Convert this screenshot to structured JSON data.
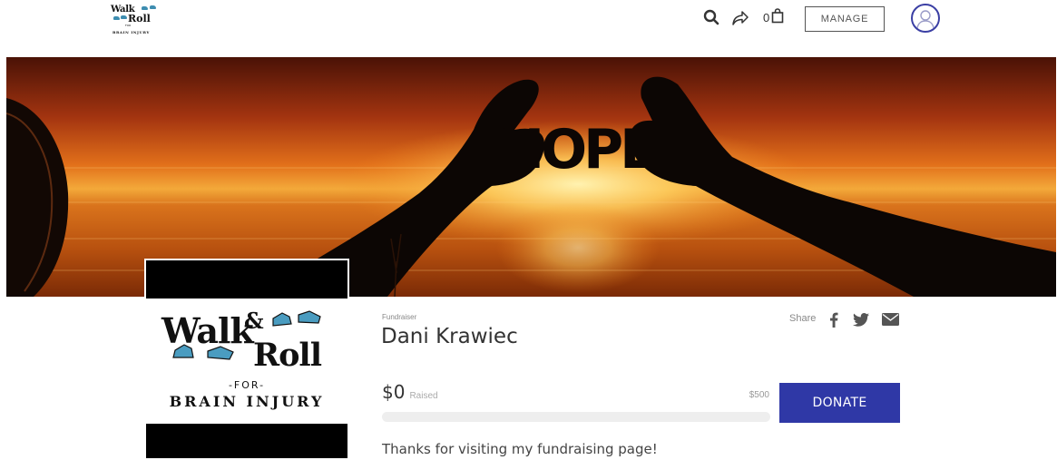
{
  "header": {
    "logo": {
      "line1": "Walk",
      "line2": "Roll",
      "line3": "FOR",
      "line4": "BRAIN INJURY"
    },
    "search_icon": "search-icon",
    "share_icon": "share-arrow-icon",
    "cart": {
      "count": "0",
      "icon": "shopping-bag-icon"
    },
    "manage_label": "MANAGE",
    "avatar_icon": "user-avatar-icon"
  },
  "banner": {
    "image_text": "HOPE",
    "description": "Sunset over the sea with silhouetted hands holding the word HOPE"
  },
  "logo_card": {
    "walk": "Walk",
    "amp": "&",
    "roll": "Roll",
    "for": "-FOR-",
    "brain_injury": "BRAIN INJURY"
  },
  "fundraiser": {
    "tag": "Fundraiser",
    "name": "Dani Krawiec",
    "share_label": "Share",
    "social_icons": [
      "facebook-icon",
      "twitter-icon",
      "email-icon"
    ],
    "raised_amount": "$0",
    "raised_label": "Raised",
    "goal": "$500",
    "progress_fraction": 0,
    "donate_label": "DONATE",
    "intro": "Thanks for visiting my fundraising page!"
  },
  "colors": {
    "accent": "#2f38a6",
    "avatar_ring": "#3b3fa4",
    "progress_track": "#eeeeee",
    "logo_shoe": "#3d8db0"
  }
}
